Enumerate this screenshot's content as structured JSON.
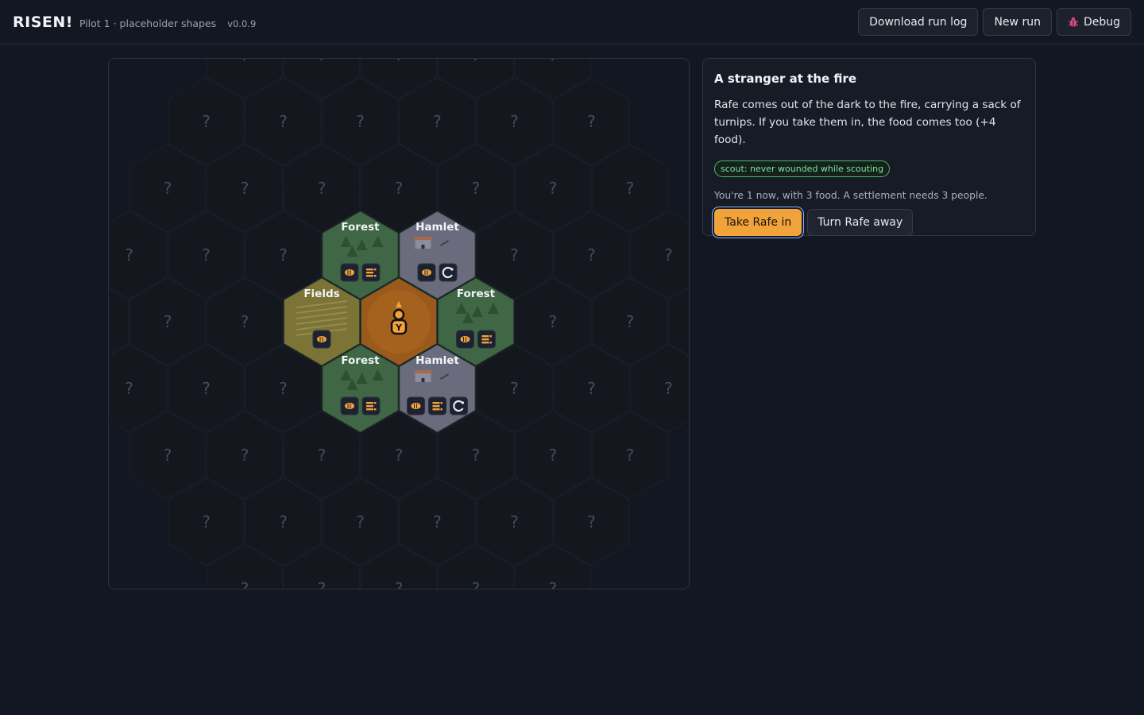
{
  "header": {
    "title": "RISEN!",
    "subtitle": "Pilot 1 · placeholder shapes",
    "version": "v0.0.9",
    "buttons": {
      "download_log": "Download run log",
      "new_run": "New run",
      "debug": "Debug"
    }
  },
  "map": {
    "unknown_label": "?",
    "center_marker": "Y",
    "terrain_colors": {
      "Forest": "#3f6645",
      "Hamlet": "#6a6c7e",
      "Fields": "#7b7436",
      "Camp": "#9a5a1c",
      "Unknown": "#14171d"
    },
    "tiles": [
      {
        "q": 0,
        "r": 0,
        "terrain": "Camp",
        "label": "",
        "icons": []
      },
      {
        "q": 0,
        "r": -1,
        "terrain": "Forest",
        "label": "Forest",
        "icons": [
          "food-icon",
          "wood-icon"
        ]
      },
      {
        "q": 1,
        "r": -1,
        "terrain": "Hamlet",
        "label": "Hamlet",
        "icons": [
          "food-icon",
          "tools-icon"
        ]
      },
      {
        "q": -1,
        "r": 0,
        "terrain": "Fields",
        "label": "Fields",
        "icons": [
          "food-icon"
        ]
      },
      {
        "q": 1,
        "r": 0,
        "terrain": "Forest",
        "label": "Forest",
        "icons": [
          "food-icon",
          "wood-icon"
        ]
      },
      {
        "q": -1,
        "r": 1,
        "terrain": "Forest",
        "label": "Forest",
        "icons": [
          "food-icon",
          "wood-icon"
        ]
      },
      {
        "q": 0,
        "r": 1,
        "terrain": "Hamlet",
        "label": "Hamlet",
        "icons": [
          "food-icon",
          "wood-icon",
          "tools-icon"
        ]
      }
    ]
  },
  "event": {
    "title": "A stranger at the fire",
    "body": "Rafe comes out of the dark to the fire, carrying a sack of turnips. If you take them in, the food comes too (+4 food).",
    "tag": "scout: never wounded while scouting",
    "status": "You're 1 now, with 3 food. A settlement needs 3 people.",
    "accept_label": "Take Rafe in",
    "reject_label": "Turn Rafe away",
    "accent": "#f0a23b"
  }
}
